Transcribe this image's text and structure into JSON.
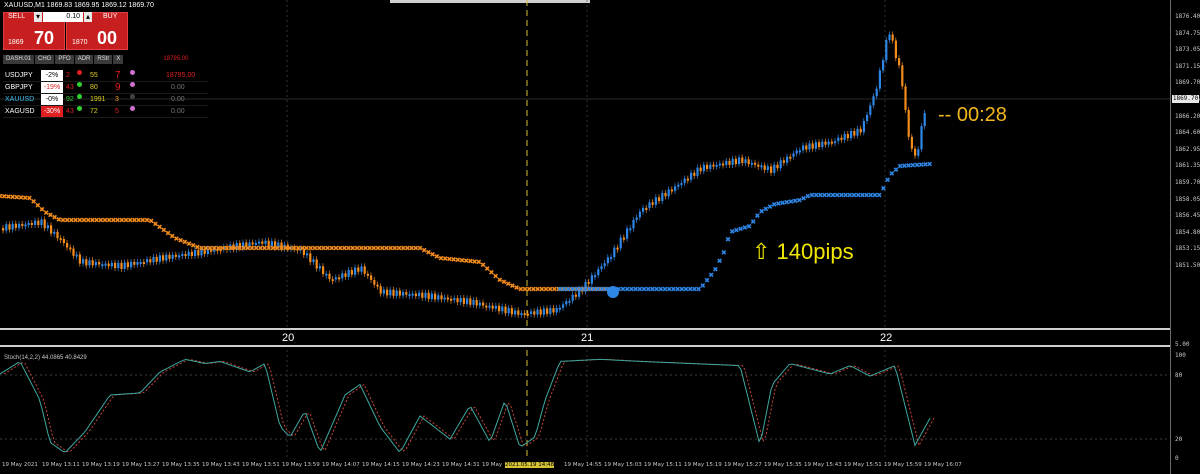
{
  "header": {
    "title": "XAUUSD,M1  1869.83 1869.95 1869.12 1869.70"
  },
  "trade_panel": {
    "sell_label": "SELL",
    "buy_label": "BUY",
    "lot": "0.10",
    "minus": "▾",
    "plus": "▴",
    "sell_small": "1869",
    "sell_big": "70",
    "buy_small": "1870",
    "buy_big": "00"
  },
  "dashboard": {
    "tab": "DASH.01",
    "headers": [
      "CHG",
      "PFO",
      "ADR",
      "RStr",
      "X"
    ],
    "header_value": "18795.00",
    "rows": [
      {
        "symbol": "USDJPY",
        "chg": "-2%",
        "a": "2",
        "b": "55",
        "c": "7",
        "value": "18795.00"
      },
      {
        "symbol": "GBPJPY",
        "chg": "-19%",
        "a": "43",
        "b": "80",
        "c": "9",
        "value": "0.00"
      },
      {
        "symbol": "XAUUSD",
        "chg": "-0%",
        "a": "92",
        "b": "1991",
        "c": "3",
        "value": "0.00"
      },
      {
        "symbol": "XAGUSD",
        "chg": "-30%",
        "a": "43",
        "b": "72",
        "c": "5",
        "value": "0.00"
      }
    ]
  },
  "annotations": {
    "pips": "⇧ 140pips",
    "timer": "--  00:28"
  },
  "price_scale": {
    "labels": [
      "1876.40",
      "1874.75",
      "1873.05",
      "1871.15",
      "1869.70",
      "1867.85",
      "1866.20",
      "1864.60",
      "1862.95",
      "1861.35",
      "1859.70",
      "1858.05",
      "1856.45",
      "1854.80",
      "1853.15",
      "1851.50"
    ],
    "current": "1869.70"
  },
  "days": [
    "20",
    "21",
    "22"
  ],
  "indicator": {
    "title": "Stoch(14,2,2) 44.0865 40.8429",
    "levels": [
      "100",
      "80",
      "20",
      "0"
    ],
    "scale_top": "5.00"
  },
  "time_axis": [
    "19 May 2021",
    "19 May 13:11",
    "19 May 13:19",
    "19 May 13:27",
    "19 May 13:35",
    "19 May 13:43",
    "19 May 13:51",
    "19 May 13:59",
    "19 May 14:07",
    "19 May 14:15",
    "19 May 14:23",
    "19 May 14:31",
    "19 May",
    "2021.05.19 14:48",
    "19 May 14:55",
    "19 May 15:03",
    "19 May 15:11",
    "19 May 15:19",
    "19 May 15:27",
    "19 May 15:35",
    "19 May 15:43",
    "19 May 15:51",
    "19 May 15:59",
    "19 May 16:07"
  ],
  "colors": {
    "bull": "#2e86e6",
    "bear": "#f28c1c",
    "vline": "#d4c232",
    "stoch_main": "#3fa8a0",
    "stoch_signal": "#c8453a"
  }
}
